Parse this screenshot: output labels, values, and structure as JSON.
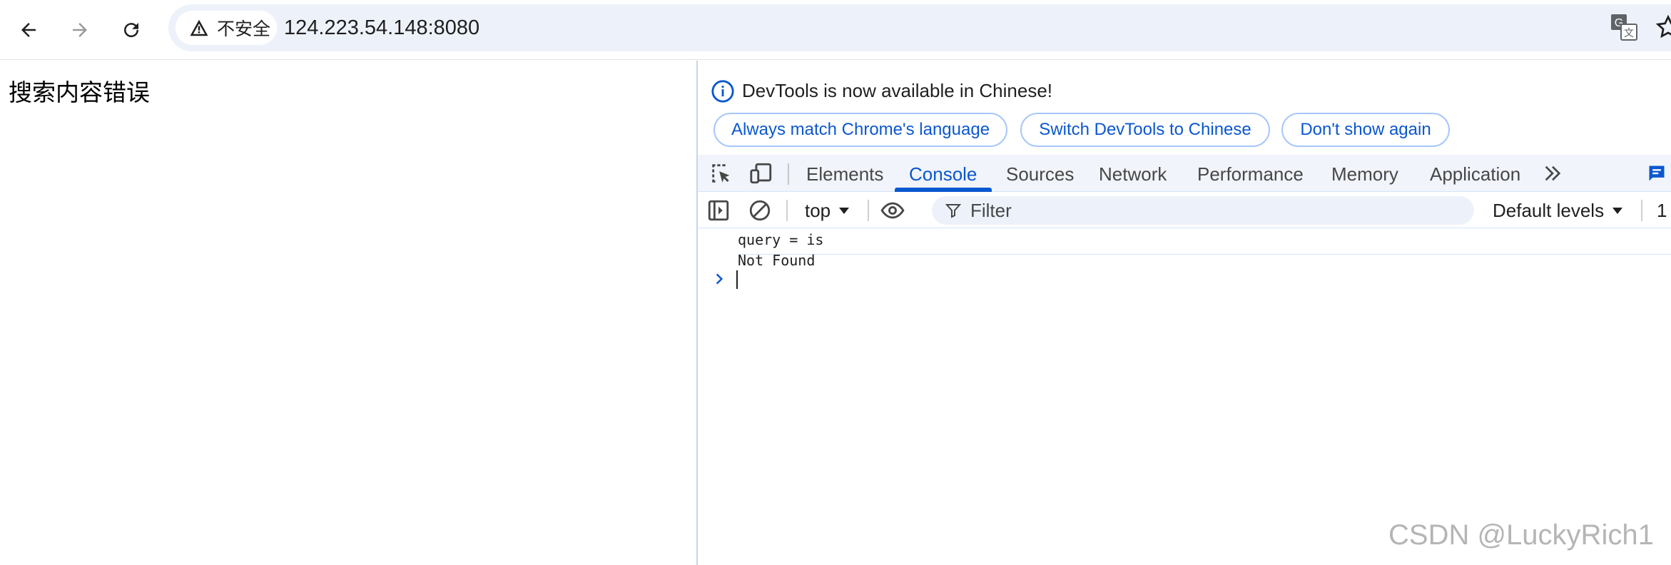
{
  "browser": {
    "back_icon": "arrow-left-icon",
    "forward_icon": "arrow-right-icon",
    "reload_icon": "reload-icon",
    "security_label": "不安全",
    "url": "124.223.54.148:8080",
    "translate_icon": "translate-icon",
    "bookmark_icon": "star-icon"
  },
  "page": {
    "message": "搜索内容错误"
  },
  "devtools": {
    "infobar": {
      "message": "DevTools is now available in Chinese!",
      "buttons": [
        "Always match Chrome's language",
        "Switch DevTools to Chinese",
        "Don't show again"
      ]
    },
    "tabs": [
      "Elements",
      "Console",
      "Sources",
      "Network",
      "Performance",
      "Memory",
      "Application"
    ],
    "active_tab": "Console",
    "console_toolbar": {
      "context": "top",
      "filter_placeholder": "Filter",
      "levels": "Default levels",
      "issues_count": "1"
    },
    "console_lines": [
      "query = is",
      "Not Found"
    ]
  },
  "watermark": "CSDN @LuckyRich1",
  "colors": {
    "accent": "#0b57d0",
    "omnibox_bg": "#edf2fa",
    "tabbar_bg": "#f1f4fa"
  }
}
